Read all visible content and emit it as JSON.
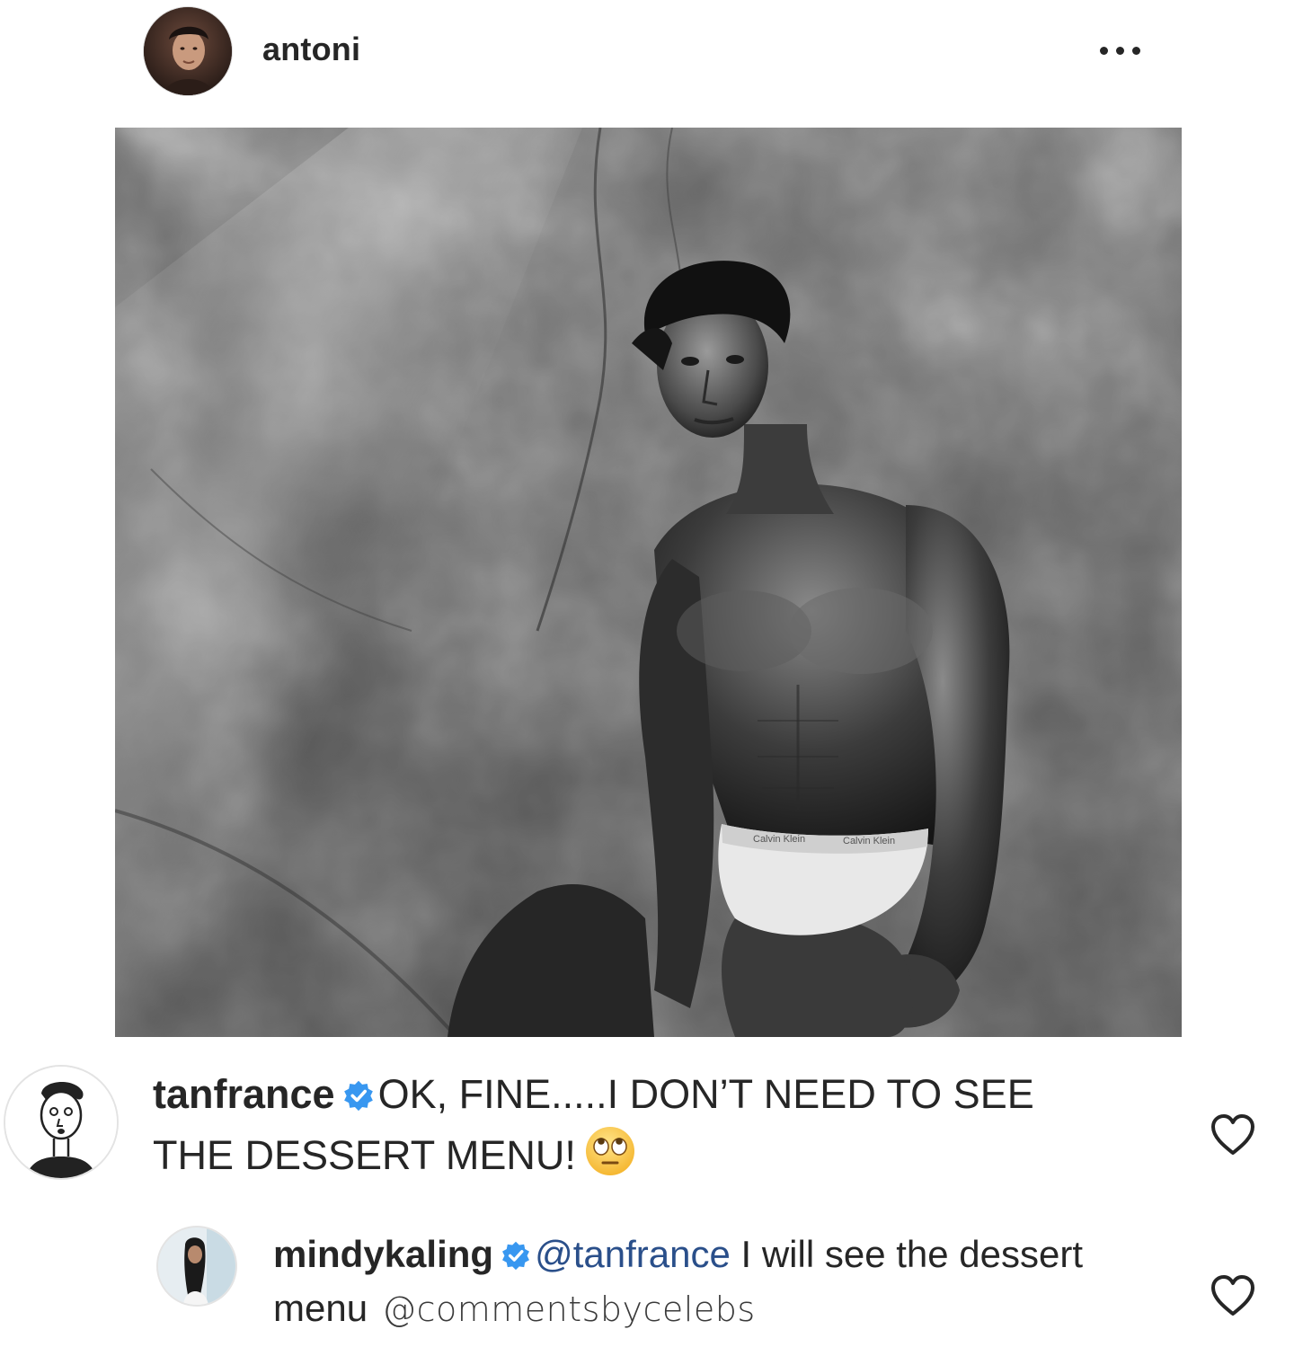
{
  "post": {
    "username": "antoni",
    "more_icon": "more-horizontal-icon",
    "photo": {
      "underwear_band_text_1": "Calvin Klein",
      "underwear_band_text_2": "Calvin Klein"
    }
  },
  "comments": [
    {
      "author": "tanfrance",
      "verified": true,
      "text": "OK, FINE.....I DON’T NEED TO SEE THE DESSERT MENU!",
      "emoji": "face-with-rolling-eyes",
      "like_icon": "heart-outline-icon"
    },
    {
      "author": "mindykaling",
      "verified": true,
      "mention": "@tanfrance",
      "text": "I will see the dessert menu",
      "watermark": "@commentsbycelebs",
      "like_icon": "heart-outline-icon"
    }
  ],
  "colors": {
    "text": "#262626",
    "verified_badge": "#3897f0",
    "mention": "#2a4f8a",
    "like_outline": "#262626"
  }
}
